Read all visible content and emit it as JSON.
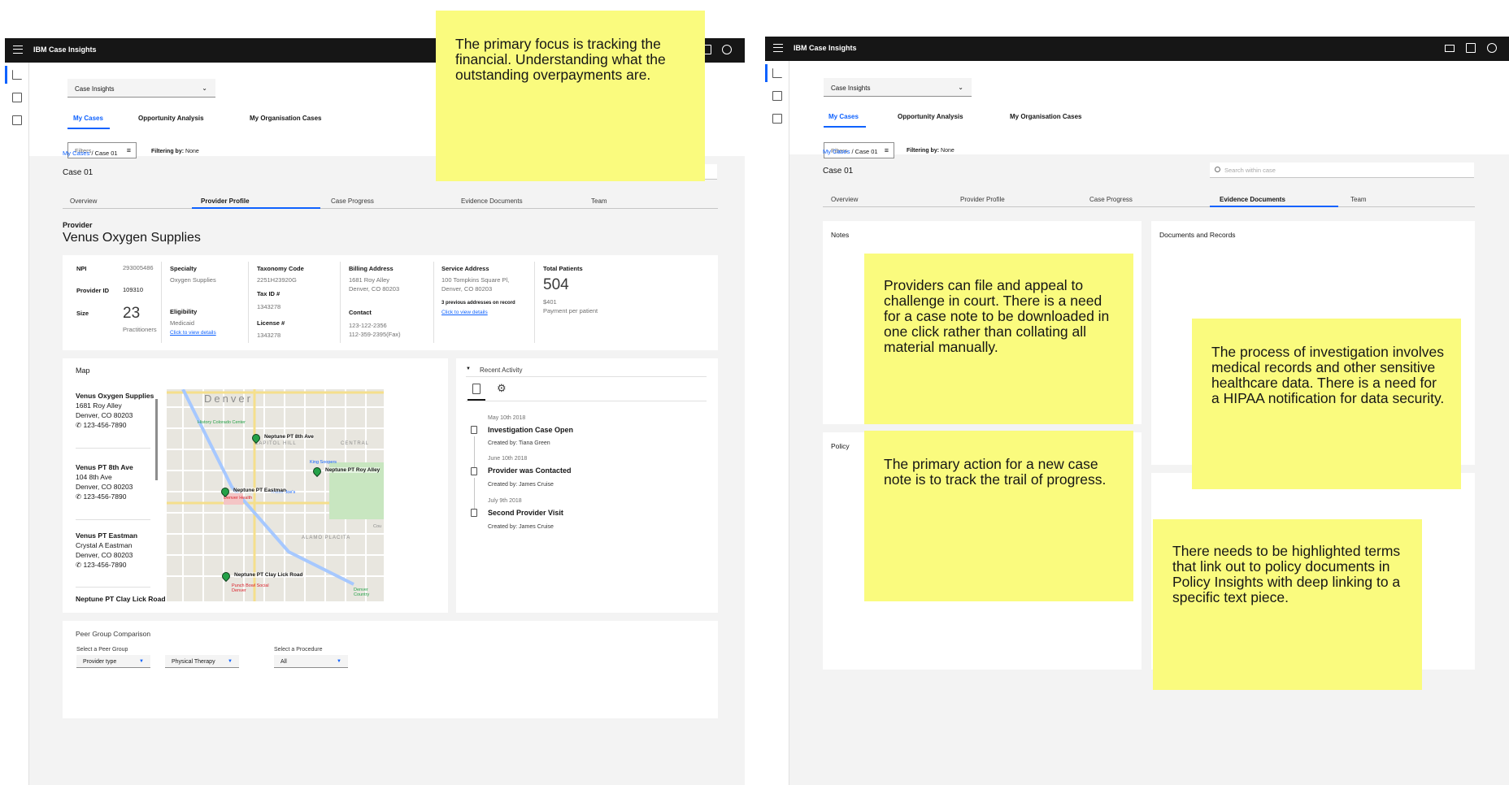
{
  "app": {
    "brand_prefix": "IBM",
    "brand_name": "Case Insights"
  },
  "header": {
    "app_select": "Case Insights",
    "tabs": [
      "My Cases",
      "Opportunity Analysis",
      "My Organisation Cases"
    ],
    "filter_placeholder": "Filters",
    "filtering_label": "Filtering by:",
    "filtering_value": "None"
  },
  "case": {
    "breadcrumb_root": "My Cases",
    "breadcrumb_sep": "/",
    "breadcrumb_current": "Case 01",
    "title": "Case 01",
    "search_placeholder": "Search within case",
    "subtabs": [
      "Overview",
      "Provider Profile",
      "Case Progress",
      "Evidence Documents",
      "Team"
    ]
  },
  "provider": {
    "label": "Provider",
    "name": "Venus Oxygen Supplies",
    "npi_label": "NPI",
    "npi": "293005486",
    "pid_label": "Provider ID",
    "pid": "109310",
    "size_label": "Size",
    "size": "23",
    "size_unit": "Practitioners",
    "specialty_label": "Specialty",
    "specialty": "Oxygen Supplies",
    "eligibility_label": "Eligibility",
    "eligibility": "Medicaid",
    "eligibility_link": "Click to view details",
    "taxonomy_label": "Taxonomy Code",
    "taxonomy": "2251H23920G",
    "taxid_label": "Tax ID #",
    "taxid": "1343278",
    "license_label": "License #",
    "license": "1343278",
    "billing_label": "Billing Address",
    "billing_1": "1681 Roy Alley",
    "billing_2": "Denver, CO 80203",
    "contact_label": "Contact",
    "contact_1": "123-122-2356",
    "contact_2": "112-359-2395(Fax)",
    "service_label": "Service Address",
    "service_1": "100 Tompkins Square Pl,",
    "service_2": "Denver, CO 80203",
    "service_prev": "3 previous addresses on record",
    "service_link": "Click to view details",
    "patients_label": "Total Patients",
    "patients": "504",
    "payment": "$401",
    "payment_label": "Payment per patient"
  },
  "map": {
    "title": "Map",
    "locations": [
      {
        "name": "Venus Oxygen Supplies",
        "addr1": "1681 Roy Alley",
        "addr2": "Denver, CO 80203",
        "phone": "123-456-7890"
      },
      {
        "name": "Venus  PT 8th Ave",
        "addr1": "104 8th Ave",
        "addr2": "Denver, CO 80203",
        "phone": "123-456-7890"
      },
      {
        "name": "Venus PT Eastman",
        "addr1": "Crystal A Eastman",
        "addr2": "Denver, CO 80203",
        "phone": "123-456-7890"
      },
      {
        "name": "Neptune PT Clay Lick Road"
      }
    ],
    "city": "Denver",
    "pins": [
      "Neptune PT 8th Ave",
      "Neptune PT Roy Alley",
      "Neptune PT Eastman",
      "Neptune PT Clay Lick Road"
    ],
    "districts": [
      "CAPITOL HILL",
      "CENTRAL",
      "ALAMO PLACITA"
    ],
    "places": [
      "History Colorado Center",
      "King Soopers",
      "Trader Joe's",
      "Denver Health",
      "Punch Bowl Social Denver",
      "Denver Country",
      "Cou"
    ]
  },
  "activity": {
    "title": "Recent Activity",
    "items": [
      {
        "date": "May 10th 2018",
        "title": "Investigation Case Open",
        "by": "Created by: Tiana Green"
      },
      {
        "date": "June 10th 2018",
        "title": "Provider was Contacted",
        "by": "Created by: James Cruise"
      },
      {
        "date": "July 9th 2018",
        "title": "Second Provider Visit",
        "by": "Created by: James Cruise"
      }
    ]
  },
  "peer": {
    "title": "Peer Group Comparison",
    "group_label": "Select a Peer Group",
    "procedure_label": "Select a Procedure",
    "dd1": "Provider type",
    "dd2": "Physical Therapy",
    "dd3": "All"
  },
  "evidence": {
    "notes_label": "Notes",
    "docs_label": "Documents and Records",
    "policy_label": "Policy"
  },
  "stickies": {
    "s1": "The primary focus is tracking the financial. Understanding what the outstanding overpayments are.",
    "s2": "Providers can file and appeal to challenge in court. There is a need for a case note to be downloaded in one click rather than collating all material manually.",
    "s3": "The primary action for a new case note is to track the trail of progress.",
    "s4": "The process of investigation involves medical records and other sensitive healthcare data. There is a need for a HIPAA notification for data security.",
    "s5": "There needs to be highlighted terms that link out to policy documents in Policy Insights with deep linking to a specific text piece."
  },
  "colors": {
    "accent": "#0f62fe",
    "sticky": "#fafb7e",
    "topbar": "#161616",
    "pin": "#24a148"
  }
}
